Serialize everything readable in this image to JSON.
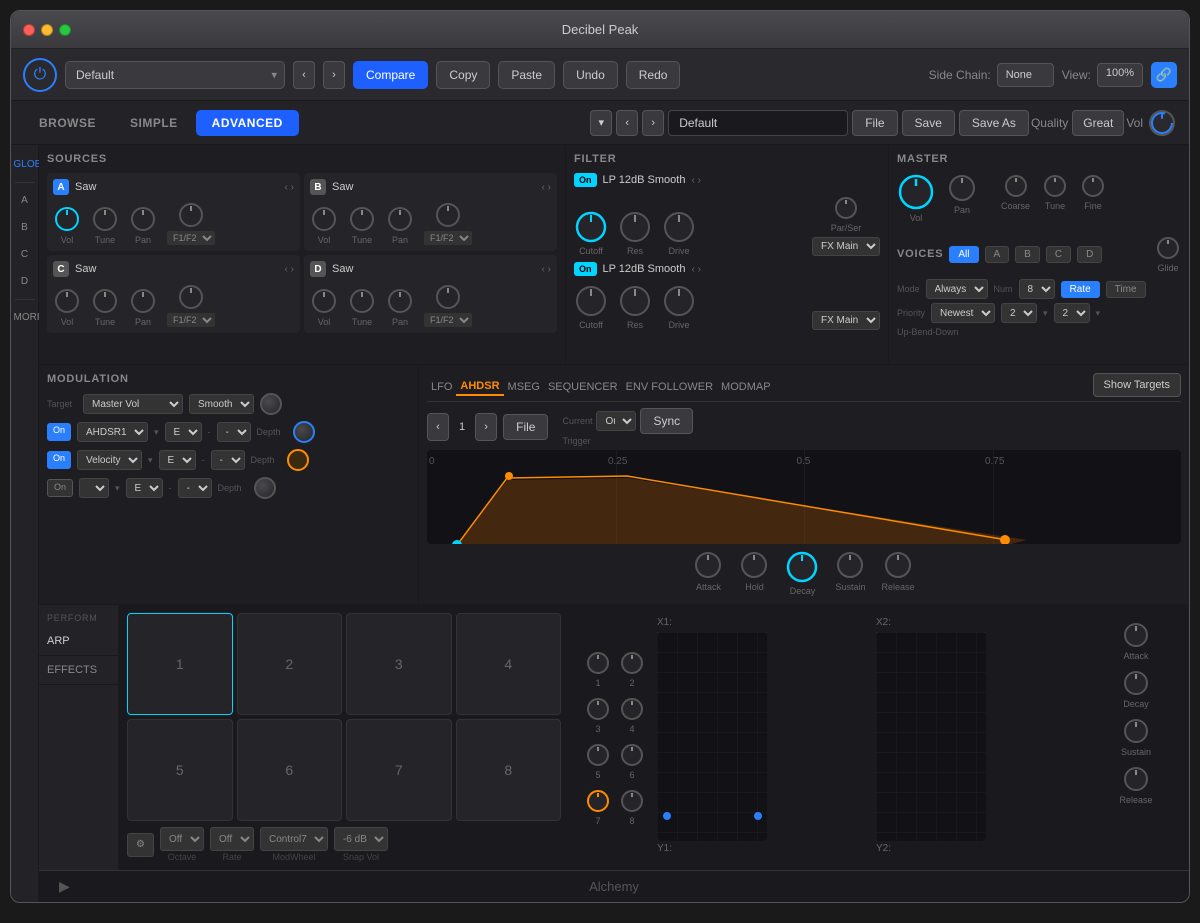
{
  "window": {
    "title": "Decibel Peak"
  },
  "titlebar": {
    "title": "Decibel Peak"
  },
  "toolbar": {
    "preset": "Default",
    "compare_label": "Compare",
    "copy_label": "Copy",
    "paste_label": "Paste",
    "undo_label": "Undo",
    "redo_label": "Redo",
    "sidechain_label": "Side Chain:",
    "sidechain_value": "None",
    "view_label": "View:",
    "view_value": "100%"
  },
  "mode_bar": {
    "browse_label": "BROWSE",
    "simple_label": "SIMPLE",
    "advanced_label": "ADVANCED",
    "file_label": "File",
    "save_label": "Save",
    "save_as_label": "Save As",
    "quality_label": "Quality",
    "quality_value": "Great",
    "vol_label": "Vol",
    "preset_name": "Default"
  },
  "sources": {
    "header": "SOURCES",
    "blocks": [
      {
        "letter": "A",
        "name": "Saw",
        "vol": "Vol",
        "tune": "Tune",
        "pan": "Pan",
        "f1f2": "F1/F2"
      },
      {
        "letter": "B",
        "name": "Saw",
        "vol": "Vol",
        "tune": "Tune",
        "pan": "Pan",
        "f1f2": "F1/F2"
      },
      {
        "letter": "C",
        "name": "Saw",
        "vol": "Vol",
        "tune": "Tune",
        "pan": "Pan",
        "f1f2": "F1/F2"
      },
      {
        "letter": "D",
        "name": "Saw",
        "vol": "Vol",
        "tune": "Tune",
        "pan": "Pan",
        "f1f2": "F1/F2"
      }
    ]
  },
  "filter": {
    "header": "FILTER",
    "filter1": {
      "on": "On",
      "name": "LP 12dB Smooth",
      "fx_dest": "FX Main",
      "cutoff": "Cutoff",
      "res": "Res",
      "drive": "Drive",
      "parser": "Par/Ser"
    },
    "filter2": {
      "on": "On",
      "name": "LP 12dB Smooth",
      "fx_dest": "FX Main",
      "cutoff": "Cutoff",
      "res": "Res",
      "drive": "Drive"
    }
  },
  "master": {
    "header": "MASTER",
    "vol_label": "Vol",
    "pan_label": "Pan",
    "coarse_label": "Coarse",
    "tune_label": "Tune",
    "fine_label": "Fine"
  },
  "voices": {
    "header": "VOICES",
    "all_btn": "All",
    "a_btn": "A",
    "b_btn": "B",
    "c_btn": "C",
    "d_btn": "D",
    "mode_label": "Mode",
    "mode_value": "Always",
    "num_label": "Num",
    "num_value": "8",
    "priority_label": "Priority",
    "priority_value": "Newest",
    "up_bend_label": "Up-Bend-Down",
    "poly_vals": [
      "2",
      "2"
    ],
    "rate_label": "Rate",
    "time_label": "Time",
    "glide_label": "Glide"
  },
  "modulation": {
    "header": "MODULATION",
    "target_label": "Target",
    "target_value": "Master Vol",
    "smooth_label": "Smooth",
    "rows": [
      {
        "on": true,
        "on_label": "On",
        "source": "AHDSR1",
        "mod": "E",
        "depth_label": "Depth"
      },
      {
        "on": true,
        "on_label": "On",
        "source": "Velocity",
        "mod": "E",
        "depth_label": "Depth"
      },
      {
        "on": false,
        "on_label": "On",
        "source": "",
        "mod": "E",
        "depth_label": "Depth"
      }
    ]
  },
  "envelope": {
    "lfo_label": "LFO",
    "ahdsr_label": "AHDSR",
    "mseg_label": "MSEG",
    "sequencer_label": "SEQUENCER",
    "env_follower_label": "ENV FOLLOWER",
    "modmap_label": "MODMAP",
    "show_targets_label": "Show Targets",
    "file_btn": "File",
    "sync_btn": "Sync",
    "on_label": "On",
    "num": "1",
    "trigger_label": "Trigger",
    "current_label": "Current",
    "grid_labels": [
      "0",
      "0.25",
      "0.5",
      "0.75"
    ],
    "knobs": {
      "attack_label": "Attack",
      "hold_label": "Hold",
      "decay_label": "Decay",
      "sustain_label": "Sustain",
      "release_label": "Release"
    }
  },
  "perform": {
    "header": "PERFORM",
    "arp_label": "ARP",
    "effects_label": "EFFECTS",
    "pads": [
      "1",
      "2",
      "3",
      "4",
      "5",
      "6",
      "7",
      "8"
    ],
    "octave_label": "Octave",
    "rate_label": "Rate",
    "modwheel_label": "ModWheel",
    "snap_vol_label": "Snap Vol",
    "octave_value": "Off",
    "rate_value": "Off",
    "modwheel_value": "Control7",
    "snap_vol_value": "-6 dB"
  },
  "xy_section": {
    "knob_labels": [
      "1",
      "2",
      "3",
      "4",
      "5",
      "6",
      "7",
      "8"
    ],
    "x1_label": "X1:",
    "x2_label": "X2:",
    "y1_label": "Y1:",
    "y2_label": "Y2:",
    "adsr": {
      "attack_label": "Attack",
      "decay_label": "Decay",
      "sustain_label": "Sustain",
      "release_label": "Release"
    }
  },
  "footer": {
    "title": "Alchemy"
  },
  "colors": {
    "accent_blue": "#2a7fff",
    "accent_cyan": "#00d4ff",
    "accent_orange": "#ff8c00",
    "bg_dark": "#1a1a1e",
    "bg_panel": "#1e1e22"
  }
}
